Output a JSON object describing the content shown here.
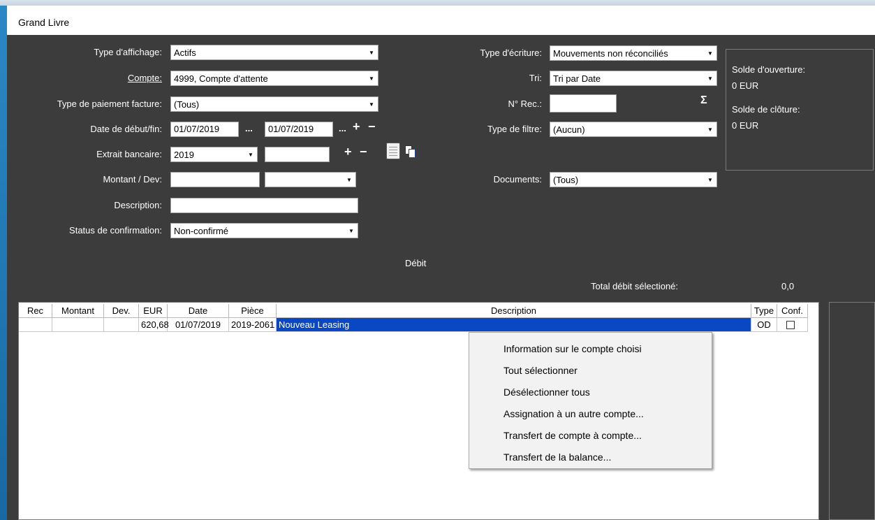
{
  "window": {
    "title": "Grand Livre"
  },
  "filters": {
    "type_affichage": {
      "label": "Type d'affichage:",
      "value": "Actifs"
    },
    "compte": {
      "label": "Compte:",
      "value": "4999, Compte d'attente"
    },
    "type_paiement": {
      "label": "Type de paiement facture:",
      "value": "(Tous)"
    },
    "date": {
      "label": "Date de début/fin:",
      "start": "01/07/2019",
      "end": "01/07/2019",
      "ellipsis": "..."
    },
    "extrait": {
      "label": "Extrait bancaire:",
      "value": "2019",
      "second": ""
    },
    "montant": {
      "label": "Montant / Dev:",
      "amount": "",
      "currency": ""
    },
    "description": {
      "label": "Description:",
      "value": ""
    },
    "status": {
      "label": "Status de confirmation:",
      "value": "Non-confirmé"
    },
    "type_ecriture": {
      "label": "Type d'écriture:",
      "value": "Mouvements non réconciliés"
    },
    "tri": {
      "label": "Tri:",
      "value": "Tri par Date"
    },
    "n_rec": {
      "label": "N° Rec.:",
      "value": ""
    },
    "type_filtre": {
      "label": "Type de filtre:",
      "value": "(Aucun)"
    },
    "documents": {
      "label": "Documents:",
      "value": "(Tous)"
    }
  },
  "symbols": {
    "plus": "+",
    "minus": "−",
    "sigma": "Σ"
  },
  "balance_panel": {
    "opening_label": "Solde d'ouverture:",
    "opening_value": "0 EUR",
    "closing_label": "Solde de clôture:",
    "closing_value": "0 EUR"
  },
  "summary": {
    "debit_heading": "Débit",
    "total_label": "Total débit sélectioné:",
    "total_value": "0,0"
  },
  "table": {
    "columns": [
      "Rec",
      "Montant",
      "Dev.",
      "EUR",
      "Date",
      "Pièce",
      "Description",
      "Type",
      "Conf."
    ],
    "rows": [
      {
        "rec": "",
        "montant": "",
        "dev": "",
        "eur": "620,68",
        "date": "01/07/2019",
        "piece": "2019-2061",
        "description": "Nouveau Leasing",
        "type": "OD",
        "conf": false
      }
    ]
  },
  "context_menu": {
    "items": [
      "Information sur le compte choisi",
      "Tout sélectionner",
      "Désélectionner tous",
      "Assignation à un autre compte...",
      "Transfert de compte à compte...",
      "Transfert de la balance..."
    ]
  }
}
